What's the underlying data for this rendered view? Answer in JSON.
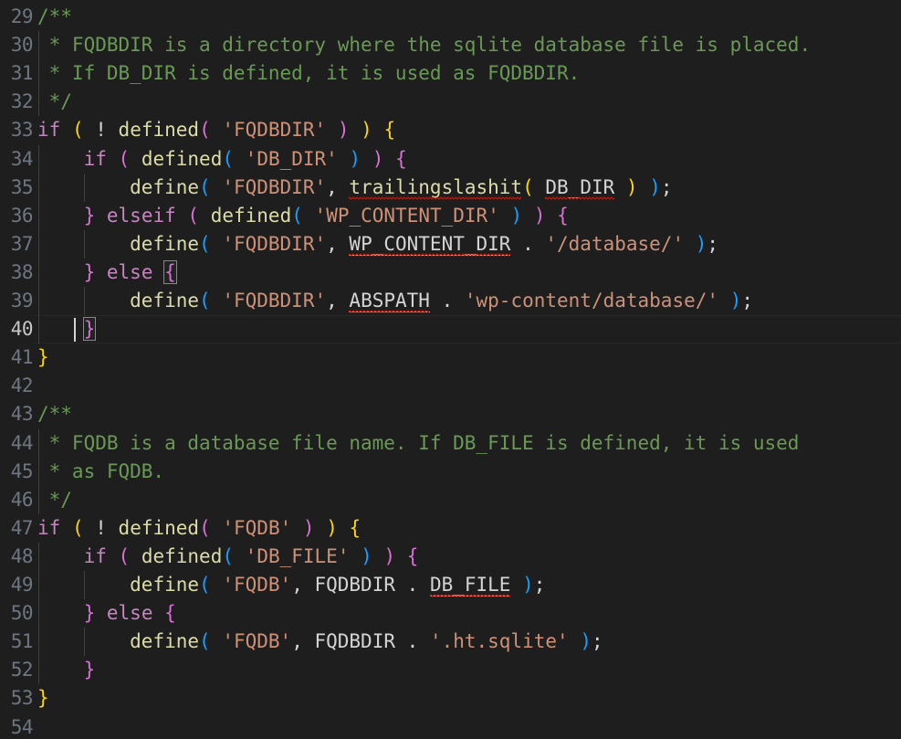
{
  "editor": {
    "language": "php",
    "theme": "dark-plus",
    "font_size_px": 21,
    "line_height_px": 31,
    "active_line": 40,
    "cursor": {
      "line": 40,
      "column": 3
    },
    "colors": {
      "background": "#1e1e1e",
      "foreground": "#d4d4d4",
      "line_number": "#6e7681",
      "line_number_active": "#c6c6c6",
      "comment": "#6A9955",
      "keyword": "#C586C0",
      "function": "#DCDCAA",
      "string": "#CE9178",
      "bracket_level_1": "#FFD700",
      "bracket_level_2": "#DA70D6",
      "bracket_level_3": "#179FFF",
      "indent_guide": "#404040",
      "error_squiggle": "#e51400",
      "active_line_border": "#282828"
    },
    "first_visible_line": 29,
    "last_visible_line": 54
  },
  "lines": [
    {
      "number": "29",
      "text": "/**"
    },
    {
      "number": "30",
      "text": " * FQDBDIR is a directory where the sqlite database file is placed."
    },
    {
      "number": "31",
      "text": " * If DB_DIR is defined, it is used as FQDBDIR."
    },
    {
      "number": "32",
      "text": " */"
    },
    {
      "number": "33",
      "text": "if ( ! defined( 'FQDBDIR' ) ) {"
    },
    {
      "number": "34",
      "text": "    if ( defined( 'DB_DIR' ) ) {"
    },
    {
      "number": "35",
      "text": "        define( 'FQDBDIR', trailingslashit( DB_DIR ) );"
    },
    {
      "number": "36",
      "text": "    } elseif ( defined( 'WP_CONTENT_DIR' ) ) {"
    },
    {
      "number": "37",
      "text": "        define( 'FQDBDIR', WP_CONTENT_DIR . '/database/' );"
    },
    {
      "number": "38",
      "text": "    } else {"
    },
    {
      "number": "39",
      "text": "        define( 'FQDBDIR', ABSPATH . 'wp-content/database/' );"
    },
    {
      "number": "40",
      "text": "    }"
    },
    {
      "number": "41",
      "text": "}"
    },
    {
      "number": "42",
      "text": ""
    },
    {
      "number": "43",
      "text": "/**"
    },
    {
      "number": "44",
      "text": " * FQDB is a database file name. If DB_FILE is defined, it is used"
    },
    {
      "number": "45",
      "text": " * as FQDB."
    },
    {
      "number": "46",
      "text": " */"
    },
    {
      "number": "47",
      "text": "if ( ! defined( 'FQDB' ) ) {"
    },
    {
      "number": "48",
      "text": "    if ( defined( 'DB_FILE' ) ) {"
    },
    {
      "number": "49",
      "text": "        define( 'FQDB', FQDBDIR . DB_FILE );"
    },
    {
      "number": "50",
      "text": "    } else {"
    },
    {
      "number": "51",
      "text": "        define( 'FQDB', FQDBDIR . '.ht.sqlite' );"
    },
    {
      "number": "52",
      "text": "    }"
    },
    {
      "number": "53",
      "text": "}"
    },
    {
      "number": "54",
      "text": ""
    }
  ],
  "tokens": {
    "l29": [
      {
        "t": "/**",
        "c": "cmt"
      }
    ],
    "l30": [
      {
        "t": " * FQDBDIR is a directory where the sqlite database file is placed.",
        "c": "cmt"
      }
    ],
    "l31": [
      {
        "t": " * If DB_DIR is defined, it is used as FQDBDIR.",
        "c": "cmt"
      }
    ],
    "l32": [
      {
        "t": " */",
        "c": "cmt"
      }
    ],
    "l33": [
      {
        "t": "if",
        "c": "kw"
      },
      {
        "t": " ",
        "c": "op"
      },
      {
        "t": "(",
        "c": "b1"
      },
      {
        "t": " ! ",
        "c": "op"
      },
      {
        "t": "defined",
        "c": "fn"
      },
      {
        "t": "(",
        "c": "b2"
      },
      {
        "t": " ",
        "c": "op"
      },
      {
        "t": "'FQDBDIR'",
        "c": "str"
      },
      {
        "t": " ",
        "c": "op"
      },
      {
        "t": ")",
        "c": "b2"
      },
      {
        "t": " ",
        "c": "op"
      },
      {
        "t": ")",
        "c": "b1"
      },
      {
        "t": " ",
        "c": "op"
      },
      {
        "t": "{",
        "c": "b1"
      }
    ],
    "l34": [
      {
        "t": "    ",
        "c": "op"
      },
      {
        "t": "if",
        "c": "kw"
      },
      {
        "t": " ",
        "c": "op"
      },
      {
        "t": "(",
        "c": "b2"
      },
      {
        "t": " ",
        "c": "op"
      },
      {
        "t": "defined",
        "c": "fn"
      },
      {
        "t": "(",
        "c": "b3"
      },
      {
        "t": " ",
        "c": "op"
      },
      {
        "t": "'DB_DIR'",
        "c": "str"
      },
      {
        "t": " ",
        "c": "op"
      },
      {
        "t": ")",
        "c": "b3"
      },
      {
        "t": " ",
        "c": "op"
      },
      {
        "t": ")",
        "c": "b2"
      },
      {
        "t": " ",
        "c": "op"
      },
      {
        "t": "{",
        "c": "b2"
      }
    ],
    "l35": [
      {
        "t": "        ",
        "c": "op"
      },
      {
        "t": "define",
        "c": "fn"
      },
      {
        "t": "(",
        "c": "b3"
      },
      {
        "t": " ",
        "c": "op"
      },
      {
        "t": "'FQDBDIR'",
        "c": "str"
      },
      {
        "t": ", ",
        "c": "op"
      },
      {
        "t": "trailingslashit",
        "c": "fn",
        "err": true
      },
      {
        "t": "(",
        "c": "b1"
      },
      {
        "t": " ",
        "c": "op"
      },
      {
        "t": "DB_DIR",
        "c": "id",
        "err": true
      },
      {
        "t": " ",
        "c": "op"
      },
      {
        "t": ")",
        "c": "b1"
      },
      {
        "t": " ",
        "c": "op"
      },
      {
        "t": ")",
        "c": "b3"
      },
      {
        "t": ";",
        "c": "punc"
      }
    ],
    "l36": [
      {
        "t": "    ",
        "c": "op"
      },
      {
        "t": "}",
        "c": "b2"
      },
      {
        "t": " ",
        "c": "op"
      },
      {
        "t": "elseif",
        "c": "kw"
      },
      {
        "t": " ",
        "c": "op"
      },
      {
        "t": "(",
        "c": "b2"
      },
      {
        "t": " ",
        "c": "op"
      },
      {
        "t": "defined",
        "c": "fn"
      },
      {
        "t": "(",
        "c": "b3"
      },
      {
        "t": " ",
        "c": "op"
      },
      {
        "t": "'WP_CONTENT_DIR'",
        "c": "str"
      },
      {
        "t": " ",
        "c": "op"
      },
      {
        "t": ")",
        "c": "b3"
      },
      {
        "t": " ",
        "c": "op"
      },
      {
        "t": ")",
        "c": "b2"
      },
      {
        "t": " ",
        "c": "op"
      },
      {
        "t": "{",
        "c": "b2"
      }
    ],
    "l37": [
      {
        "t": "        ",
        "c": "op"
      },
      {
        "t": "define",
        "c": "fn"
      },
      {
        "t": "(",
        "c": "b3"
      },
      {
        "t": " ",
        "c": "op"
      },
      {
        "t": "'FQDBDIR'",
        "c": "str"
      },
      {
        "t": ", ",
        "c": "op"
      },
      {
        "t": "WP_CONTENT_DIR",
        "c": "idu",
        "err": true
      },
      {
        "t": " . ",
        "c": "op"
      },
      {
        "t": "'/database/'",
        "c": "str"
      },
      {
        "t": " ",
        "c": "op"
      },
      {
        "t": ")",
        "c": "b3"
      },
      {
        "t": ";",
        "c": "punc"
      }
    ],
    "l38": [
      {
        "t": "    ",
        "c": "op"
      },
      {
        "t": "}",
        "c": "b2"
      },
      {
        "t": " ",
        "c": "op"
      },
      {
        "t": "else",
        "c": "kw"
      },
      {
        "t": " ",
        "c": "op"
      },
      {
        "t": "{",
        "c": "b2",
        "match": true
      }
    ],
    "l39": [
      {
        "t": "        ",
        "c": "op"
      },
      {
        "t": "define",
        "c": "fn"
      },
      {
        "t": "(",
        "c": "b3"
      },
      {
        "t": " ",
        "c": "op"
      },
      {
        "t": "'FQDBDIR'",
        "c": "str"
      },
      {
        "t": ", ",
        "c": "op"
      },
      {
        "t": "ABSPATH",
        "c": "idu",
        "err": true
      },
      {
        "t": " . ",
        "c": "op"
      },
      {
        "t": "'wp-content/database/'",
        "c": "str"
      },
      {
        "t": " ",
        "c": "op"
      },
      {
        "t": ")",
        "c": "b3"
      },
      {
        "t": ";",
        "c": "punc"
      }
    ],
    "l40": [
      {
        "t": "    ",
        "c": "op"
      },
      {
        "t": "}",
        "c": "b2",
        "match": true
      }
    ],
    "l41": [
      {
        "t": "}",
        "c": "b1"
      }
    ],
    "l42": [],
    "l43": [
      {
        "t": "/**",
        "c": "cmt"
      }
    ],
    "l44": [
      {
        "t": " * FQDB is a database file name. If DB_FILE is defined, it is used",
        "c": "cmt"
      }
    ],
    "l45": [
      {
        "t": " * as FQDB.",
        "c": "cmt"
      }
    ],
    "l46": [
      {
        "t": " */",
        "c": "cmt"
      }
    ],
    "l47": [
      {
        "t": "if",
        "c": "kw"
      },
      {
        "t": " ",
        "c": "op"
      },
      {
        "t": "(",
        "c": "b1"
      },
      {
        "t": " ! ",
        "c": "op"
      },
      {
        "t": "defined",
        "c": "fn"
      },
      {
        "t": "(",
        "c": "b2"
      },
      {
        "t": " ",
        "c": "op"
      },
      {
        "t": "'FQDB'",
        "c": "str"
      },
      {
        "t": " ",
        "c": "op"
      },
      {
        "t": ")",
        "c": "b2"
      },
      {
        "t": " ",
        "c": "op"
      },
      {
        "t": ")",
        "c": "b1"
      },
      {
        "t": " ",
        "c": "op"
      },
      {
        "t": "{",
        "c": "b1"
      }
    ],
    "l48": [
      {
        "t": "    ",
        "c": "op"
      },
      {
        "t": "if",
        "c": "kw"
      },
      {
        "t": " ",
        "c": "op"
      },
      {
        "t": "(",
        "c": "b2"
      },
      {
        "t": " ",
        "c": "op"
      },
      {
        "t": "defined",
        "c": "fn"
      },
      {
        "t": "(",
        "c": "b3"
      },
      {
        "t": " ",
        "c": "op"
      },
      {
        "t": "'DB_FILE'",
        "c": "str"
      },
      {
        "t": " ",
        "c": "op"
      },
      {
        "t": ")",
        "c": "b3"
      },
      {
        "t": " ",
        "c": "op"
      },
      {
        "t": ")",
        "c": "b2"
      },
      {
        "t": " ",
        "c": "op"
      },
      {
        "t": "{",
        "c": "b2"
      }
    ],
    "l49": [
      {
        "t": "        ",
        "c": "op"
      },
      {
        "t": "define",
        "c": "fn"
      },
      {
        "t": "(",
        "c": "b3"
      },
      {
        "t": " ",
        "c": "op"
      },
      {
        "t": "'FQDB'",
        "c": "str"
      },
      {
        "t": ", ",
        "c": "op"
      },
      {
        "t": "FQDBDIR",
        "c": "id"
      },
      {
        "t": " . ",
        "c": "op"
      },
      {
        "t": "DB_FILE",
        "c": "idu",
        "err": true
      },
      {
        "t": " ",
        "c": "op"
      },
      {
        "t": ")",
        "c": "b3"
      },
      {
        "t": ";",
        "c": "punc"
      }
    ],
    "l50": [
      {
        "t": "    ",
        "c": "op"
      },
      {
        "t": "}",
        "c": "b2"
      },
      {
        "t": " ",
        "c": "op"
      },
      {
        "t": "else",
        "c": "kw"
      },
      {
        "t": " ",
        "c": "op"
      },
      {
        "t": "{",
        "c": "b2"
      }
    ],
    "l51": [
      {
        "t": "        ",
        "c": "op"
      },
      {
        "t": "define",
        "c": "fn"
      },
      {
        "t": "(",
        "c": "b3"
      },
      {
        "t": " ",
        "c": "op"
      },
      {
        "t": "'FQDB'",
        "c": "str"
      },
      {
        "t": ", ",
        "c": "op"
      },
      {
        "t": "FQDBDIR",
        "c": "id"
      },
      {
        "t": " . ",
        "c": "op"
      },
      {
        "t": "'.ht.sqlite'",
        "c": "str"
      },
      {
        "t": " ",
        "c": "op"
      },
      {
        "t": ")",
        "c": "b3"
      },
      {
        "t": ";",
        "c": "punc"
      }
    ],
    "l52": [
      {
        "t": "    ",
        "c": "op"
      },
      {
        "t": "}",
        "c": "b2"
      }
    ],
    "l53": [
      {
        "t": "}",
        "c": "b1"
      }
    ],
    "l54": []
  },
  "indent_guides": {
    "l30": [
      1
    ],
    "l31": [
      1
    ],
    "l32": [
      1
    ],
    "l34": [
      1
    ],
    "l35": [
      1,
      2
    ],
    "l36": [
      1
    ],
    "l37": [
      1,
      2
    ],
    "l38": [
      1
    ],
    "l39": [
      1,
      2
    ],
    "l40": [
      1
    ],
    "l44": [
      1
    ],
    "l45": [
      1
    ],
    "l46": [
      1
    ],
    "l48": [
      1
    ],
    "l49": [
      1,
      2
    ],
    "l50": [
      1
    ],
    "l51": [
      1,
      2
    ],
    "l52": [
      1
    ]
  }
}
